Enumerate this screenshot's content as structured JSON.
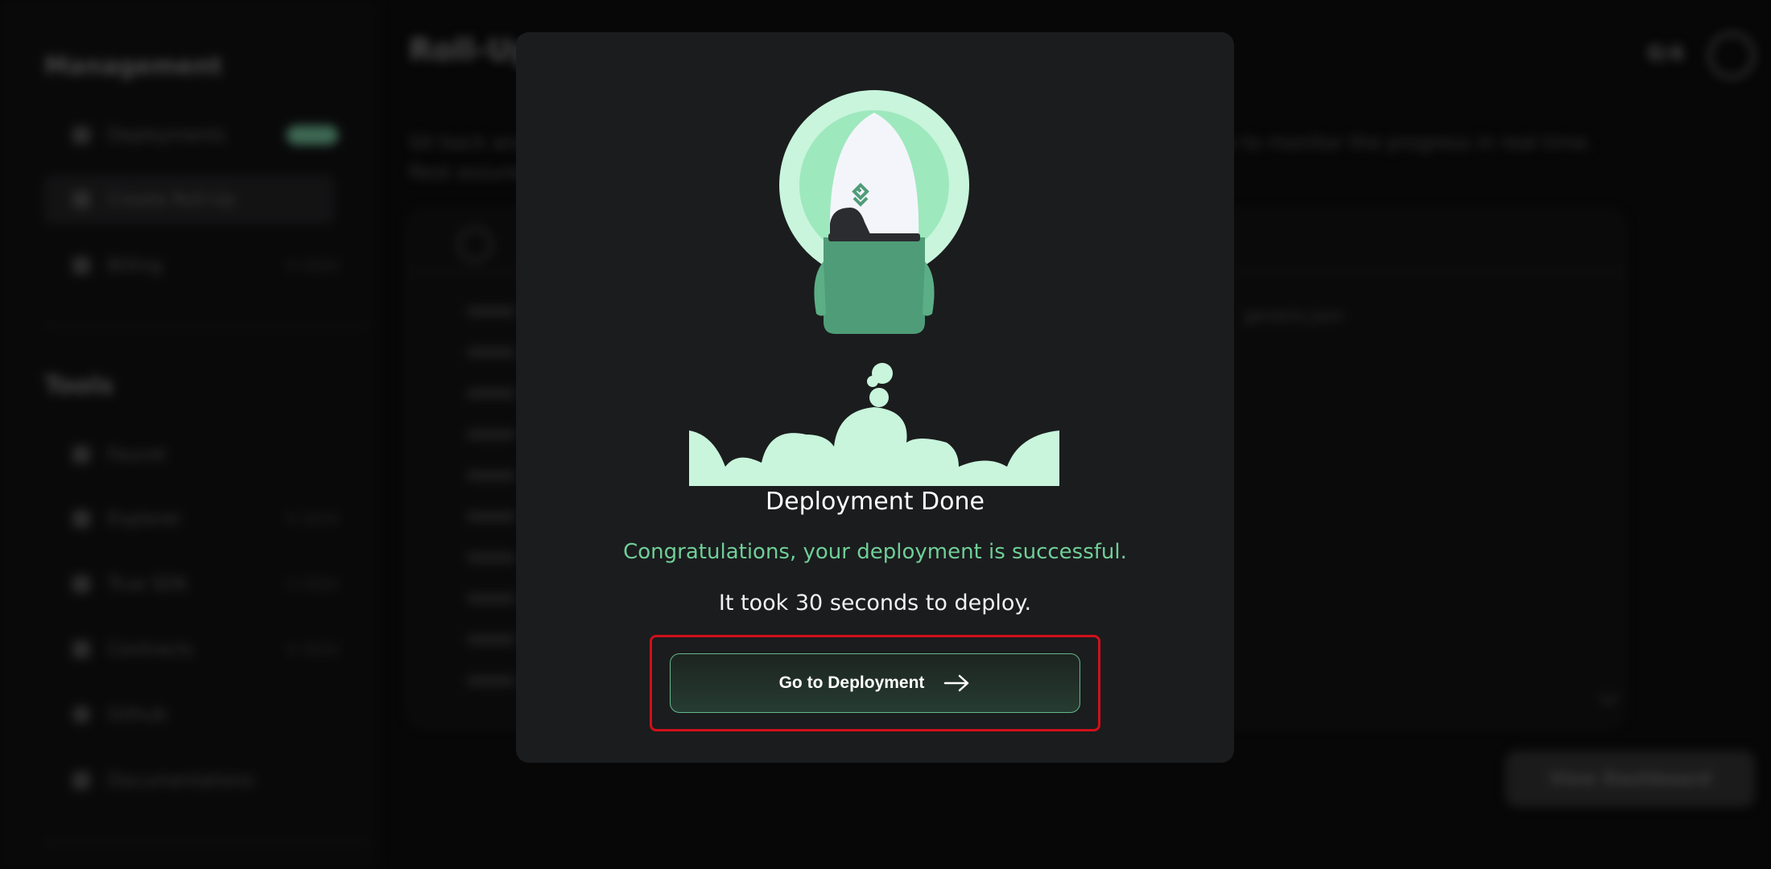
{
  "background": {
    "sidebar": {
      "management_title": "Management",
      "items": [
        {
          "label": "Deployments",
          "tag": ""
        },
        {
          "label": "Create Roll-Up",
          "tag": ""
        },
        {
          "label": "Billing",
          "tag": "V 2024"
        }
      ],
      "tools_title": "Tools",
      "tools": [
        {
          "label": "Faucet",
          "tag": ""
        },
        {
          "label": "Explorer",
          "tag": "V 2024"
        },
        {
          "label": "True SDK",
          "tag": "V 2024"
        },
        {
          "label": "Contracts",
          "tag": "V 2024"
        },
        {
          "label": "Github",
          "tag": ""
        },
        {
          "label": "Documentations",
          "tag": ""
        }
      ]
    },
    "main": {
      "title": "Roll-Up",
      "desc_line1": "Sit back and relax while your roll-up is being deployed. Check the building logs below to monitor the progress in real time.",
      "desc_line2": "Rest assured.",
      "log_file": "genesis.json",
      "dashboard_button": "View Dashboard",
      "avatar_text": "0/4"
    }
  },
  "modal": {
    "title": "Deployment Done",
    "success_message": "Congratulations, your deployment is successful.",
    "duration_message": "It took 30 seconds to deploy.",
    "cta_label": "Go to Deployment",
    "accent_color": "#6fcf97",
    "cta_icon": "arrow-right-icon"
  }
}
